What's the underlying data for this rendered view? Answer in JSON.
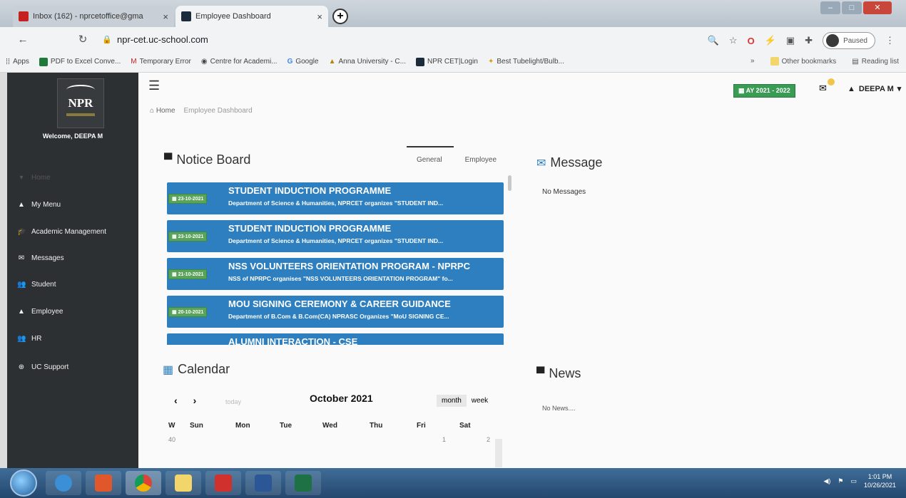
{
  "browser": {
    "tabs": [
      {
        "label": "Inbox (162) - nprcetoffice@gma",
        "close": "×",
        "favicon_color": "#c5221f"
      },
      {
        "label": "Employee Dashboard",
        "close": "×",
        "favicon_color": "#1a2b3c"
      }
    ],
    "new_tab": "+",
    "url": "npr-cet.uc-school.com",
    "profile_status": "Paused",
    "bookmarks": [
      {
        "label": "Apps"
      },
      {
        "label": "PDF to Excel Conve..."
      },
      {
        "label": "Temporary Error"
      },
      {
        "label": "Centre for Academi..."
      },
      {
        "label": "Google"
      },
      {
        "label": "Anna University - C..."
      },
      {
        "label": "NPR CET|Login"
      },
      {
        "label": "Best Tubelight/Bulb..."
      }
    ],
    "bookmarks_overflow": "»",
    "other_bookmarks": "Other bookmarks",
    "reading_list": "Reading list"
  },
  "sidebar": {
    "logo_text": "NPR",
    "welcome": "Welcome, DEEPA M",
    "items": [
      {
        "label": "Home",
        "icon": "▾"
      },
      {
        "label": "My Menu",
        "icon": "▲"
      },
      {
        "label": "Academic Management",
        "icon": "🎓"
      },
      {
        "label": "Messages",
        "icon": "✉"
      },
      {
        "label": "Student",
        "icon": "👥"
      },
      {
        "label": "Employee",
        "icon": "▲"
      },
      {
        "label": "HR",
        "icon": "👥"
      },
      {
        "label": "UC Support",
        "icon": "⊕"
      }
    ]
  },
  "header": {
    "academic_year": "AY 2021 - 2022",
    "user_name": "DEEPA M",
    "user_caret": "▾"
  },
  "breadcrumb": {
    "home": "Home",
    "current": "Employee Dashboard"
  },
  "notice_board": {
    "title": "Notice Board",
    "tabs": [
      "General",
      "Employee"
    ],
    "notices": [
      {
        "date": "23-10-2021",
        "title": "STUDENT INDUCTION PROGRAMME",
        "desc": "Department of Science & Humanities, NPRCET organizes \"STUDENT IND..."
      },
      {
        "date": "23-10-2021",
        "title": "STUDENT INDUCTION PROGRAMME",
        "desc": "Department of Science & Humanities, NPRCET organizes \"STUDENT IND..."
      },
      {
        "date": "21-10-2021",
        "title": "NSS VOLUNTEERS ORIENTATION PROGRAM - NPRPC",
        "desc": "NSS of NPRPC organises \"NSS VOLUNTEERS ORIENTATION PROGRAM\" fo..."
      },
      {
        "date": "20-10-2021",
        "title": "MOU SIGNING CEREMONY & CAREER GUIDANCE",
        "desc": "Department of B.Com & B.Com(CA) NPRASC Organizes \"MoU SIGNING CE..."
      },
      {
        "date": "",
        "title": "ALUMNI INTERACTION - CSE",
        "desc": ""
      }
    ]
  },
  "message": {
    "title": "Message",
    "empty": "No Messages"
  },
  "calendar": {
    "title": "Calendar",
    "prev": "‹",
    "next": "›",
    "today": "today",
    "month_label": "October 2021",
    "views": [
      "month",
      "week"
    ],
    "headers": [
      "W",
      "Sun",
      "Mon",
      "Tue",
      "Wed",
      "Thu",
      "Fri",
      "Sat"
    ],
    "first_row": {
      "week": "40",
      "fri": "1",
      "sat": "2"
    }
  },
  "news": {
    "title": "News",
    "empty": "No News...."
  },
  "taskbar": {
    "clock_time": "1:01 PM",
    "clock_date": "10/26/2021"
  }
}
